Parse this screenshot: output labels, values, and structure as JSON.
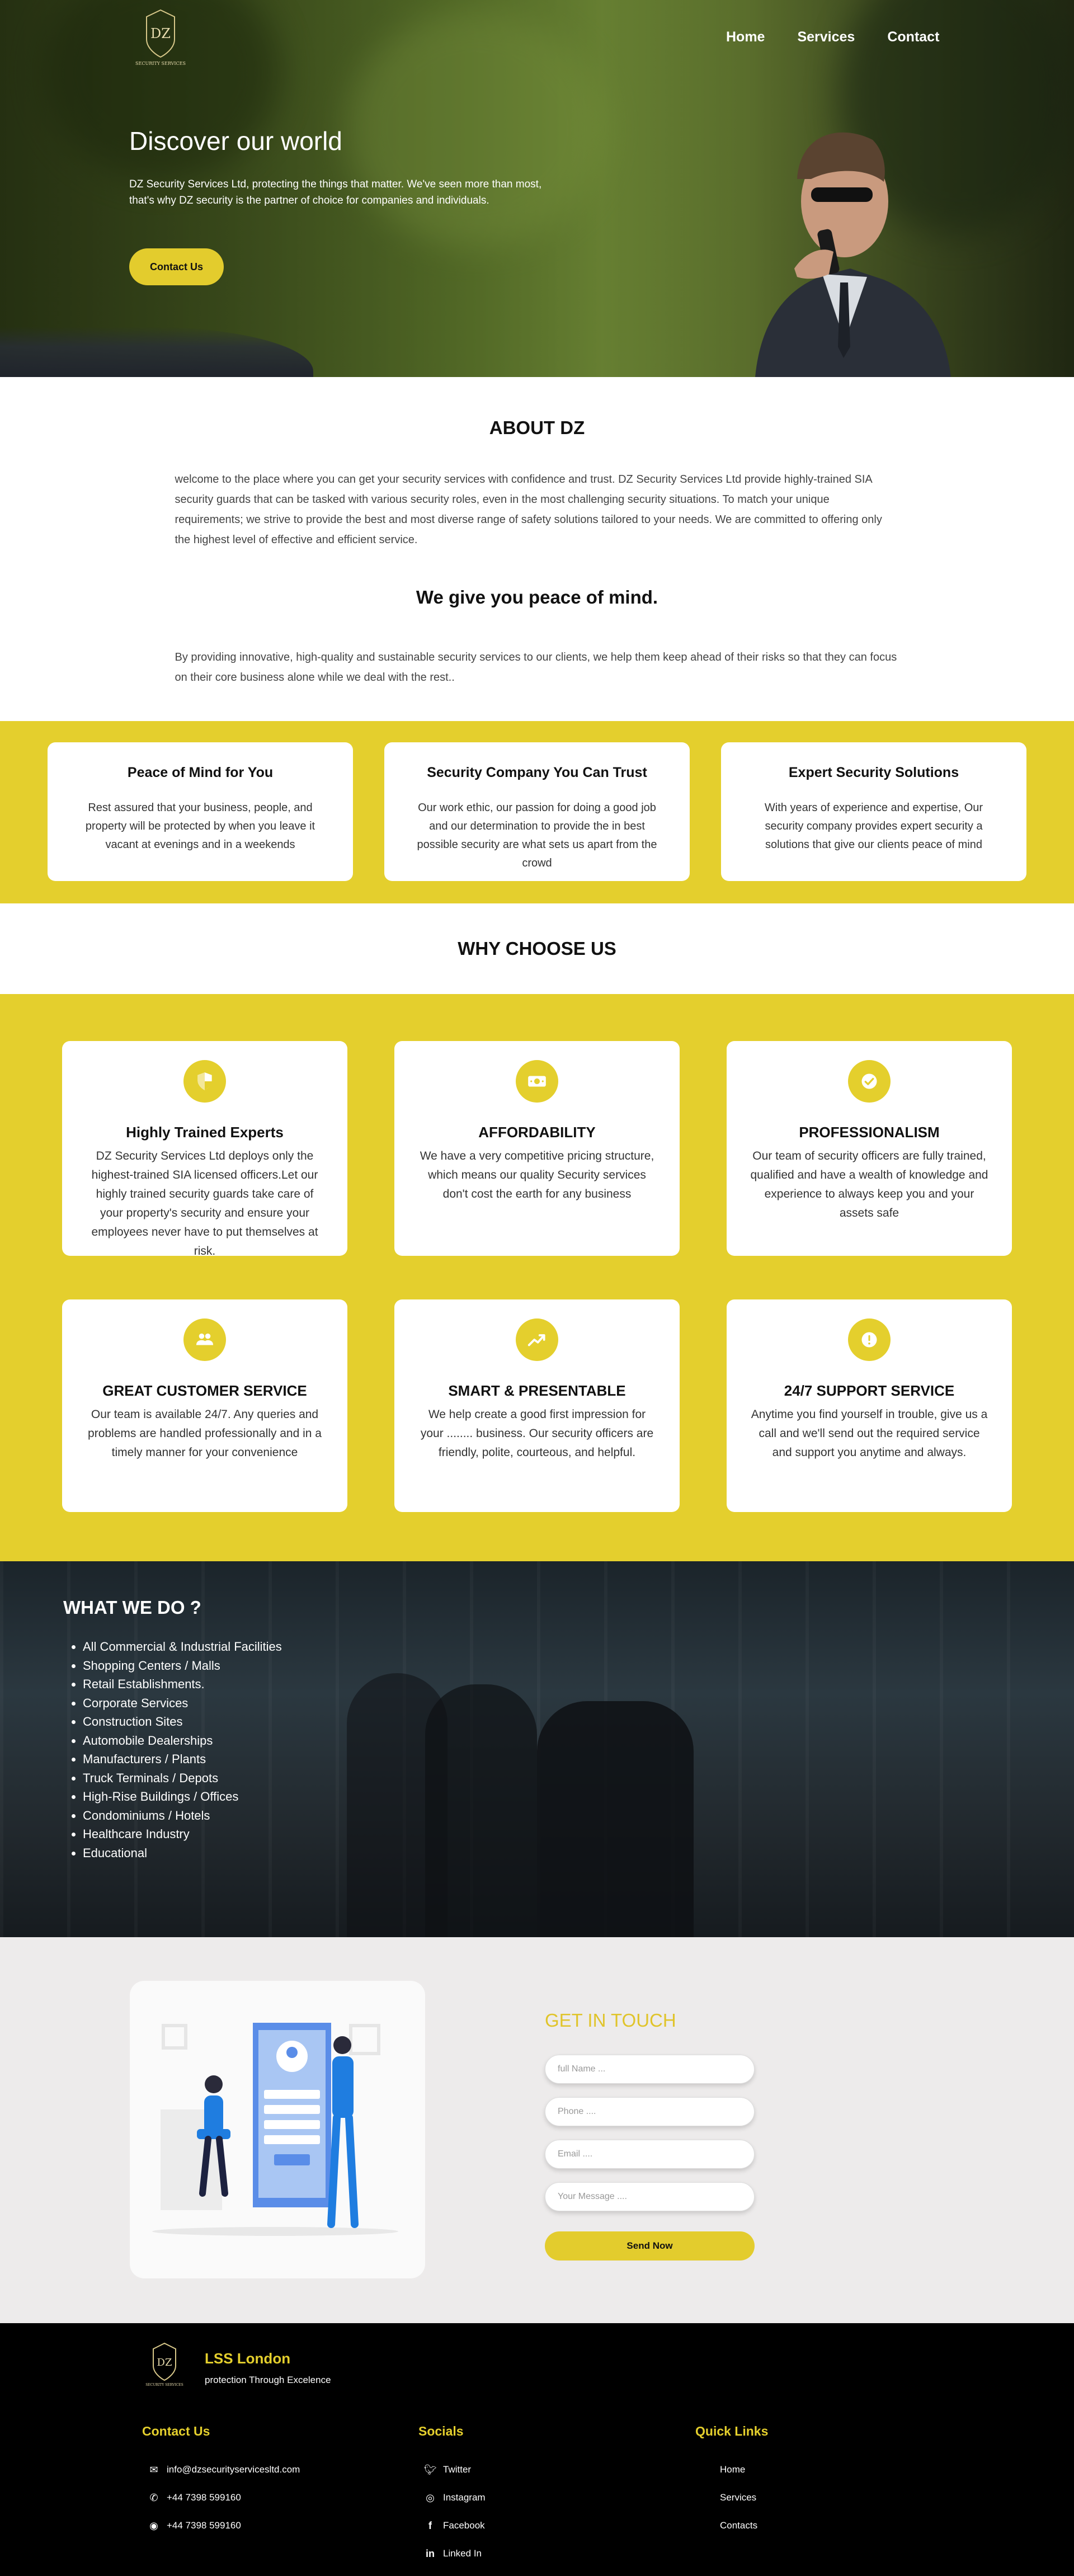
{
  "header": {
    "logo_text": "DZ",
    "logo_caption": "SECURITY SERVICES",
    "nav": [
      "Home",
      "Services",
      "Contact"
    ]
  },
  "hero": {
    "title": "Discover our world",
    "text": "DZ Security Services Ltd, protecting the things that matter. We've seen more than most, that's why DZ security is the partner of choice for companies and individuals.",
    "button": "Contact Us"
  },
  "about": {
    "title": "ABOUT DZ",
    "text": "welcome to the place where you can get your security services with confidence and trust. DZ Security Services Ltd provide highly-trained SIA security guards that can be tasked with various security roles, even in the most challenging security situations. To match your unique requirements; we strive to provide the best and most diverse range of safety solutions tailored to your needs. We are committed to offering only the highest level of effective and efficient service.",
    "subtitle": "We give you peace of mind.",
    "subtext": "By providing innovative, high-quality and sustainable security services to our clients, we help them keep ahead of their risks so that they can focus on their core business alone while we deal with the rest.."
  },
  "features": [
    {
      "title": "Peace of Mind for You",
      "text": "Rest assured that your business, people, and property will be protected by when you leave it vacant at evenings and in a weekends"
    },
    {
      "title": "Security Company You Can Trust",
      "text": "Our work ethic, our passion for doing a good job and our determination to provide the in best possible security are what sets us apart from the crowd"
    },
    {
      "title": "Expert Security Solutions",
      "text": "With years of experience and expertise, Our security company provides expert security a solutions that give our clients peace of mind"
    }
  ],
  "why": {
    "title": "WHY CHOOSE US",
    "cards": [
      {
        "icon": "shield-icon",
        "title": "Highly Trained Experts",
        "text": "DZ Security Services Ltd deploys only the highest-trained SIA licensed officers.Let our highly trained security guards take care of your property's security and ensure your employees never have to put themselves at risk."
      },
      {
        "icon": "money-icon",
        "title": "AFFORDABILITY",
        "text": "We have a very competitive pricing structure, which means our quality Security services don't cost the earth for any business"
      },
      {
        "icon": "check-badge-icon",
        "title": "PROFESSIONALISM",
        "text": "Our team of security officers are fully trained, qualified and have a wealth of knowledge and experience to always keep you and your assets safe"
      },
      {
        "icon": "group-icon",
        "title": "GREAT CUSTOMER SERVICE",
        "text": "Our team is available 24/7. Any queries and problems are handled professionally and in a timely manner for your convenience"
      },
      {
        "icon": "trend-icon",
        "title": "SMART & PRESENTABLE",
        "text": "We help create a good first impression for your ........ business. Our security officers are friendly, polite, courteous, and helpful."
      },
      {
        "icon": "alert-icon",
        "title": "24/7 SUPPORT SERVICE",
        "text": "Anytime you find yourself in trouble, give us a call and we'll send out the required service and support you anytime and always."
      }
    ]
  },
  "whatwedo": {
    "title": "WHAT WE DO ?",
    "items": [
      "All Commercial & Industrial Facilities",
      "Shopping Centers / Malls",
      "Retail Establishments.",
      "Corporate Services",
      "Construction Sites",
      "Automobile Dealerships",
      "Manufacturers / Plants",
      "Truck Terminals / Depots",
      "High-Rise Buildings / Offices",
      "Condominiums / Hotels",
      "Healthcare Industry",
      "Educational"
    ]
  },
  "contact": {
    "title": "GET IN TOUCH",
    "name_placeholder": "full Name ...",
    "phone_placeholder": "Phone ....",
    "email_placeholder": "Email ....",
    "message_placeholder": "Your Message ....",
    "button": "Send Now"
  },
  "footer": {
    "brand": "LSS London",
    "tagline": "protection Through Excelence",
    "contact_title": "Contact Us",
    "email": "info@dzsecurityservicesltd.com",
    "phone1": "+44 7398 599160",
    "phone2": "+44 7398 599160",
    "socials_title": "Socials",
    "twitter": "Twitter",
    "instagram": "Instagram",
    "facebook": "Facebook",
    "linkedin": "Linked In",
    "links_title": "Quick Links",
    "link_home": "Home",
    "link_services": "Services",
    "link_contacts": "Contacts"
  },
  "colors": {
    "accent": "#e4cf2d",
    "dark": "#000000",
    "light_bg": "#edebeb"
  }
}
